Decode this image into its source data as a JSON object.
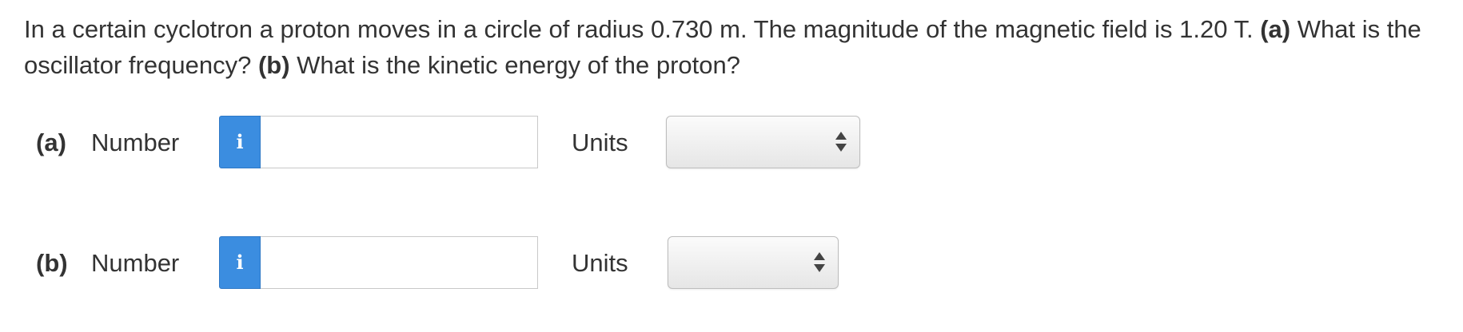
{
  "question": {
    "text_1": "In a certain cyclotron a proton moves in a circle of radius 0.730 m. The magnitude of the magnetic field is 1.20 T. ",
    "part_a_marker": "(a)",
    "text_2": " What is the oscillator frequency? ",
    "part_b_marker": "(b)",
    "text_3": " What is the kinetic energy of the proton?"
  },
  "parts": [
    {
      "label": "(a)",
      "number_label": "Number",
      "info_icon": "i",
      "number_value": "",
      "units_label": "Units",
      "units_selected": ""
    },
    {
      "label": "(b)",
      "number_label": "Number",
      "info_icon": "i",
      "number_value": "",
      "units_label": "Units",
      "units_selected": ""
    }
  ],
  "colors": {
    "info_button": "#3b8de0",
    "text": "#333333",
    "input_border": "#c8c8c8"
  }
}
